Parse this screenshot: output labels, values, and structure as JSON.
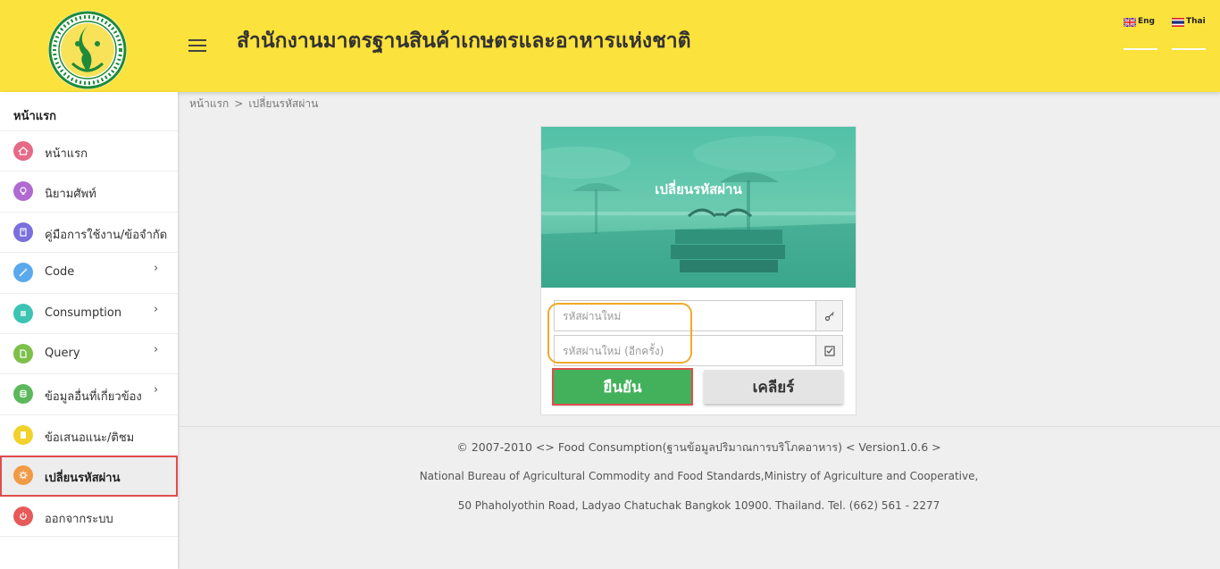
{
  "header": {
    "title": "สำนักงานมาตรฐานสินค้าเกษตรและอาหารแห่งชาติ",
    "lang_eng": "Eng",
    "lang_thai": "Thai"
  },
  "sidebar": {
    "heading": "หน้าแรก",
    "items": [
      {
        "label": "หน้าแรก",
        "icon": "home-icon",
        "color": "#e66a86",
        "has_submenu": false
      },
      {
        "label": "นิยามศัพท์",
        "icon": "bulb-icon",
        "color": "#b06ad2",
        "has_submenu": false
      },
      {
        "label": "คู่มือการใช้งาน/ข้อจำกัด",
        "icon": "book-icon",
        "color": "#7a6fdc",
        "has_submenu": false
      },
      {
        "label": "Code",
        "icon": "wand-icon",
        "color": "#5aa9ee",
        "has_submenu": true
      },
      {
        "label": "Consumption",
        "icon": "list-icon",
        "color": "#3cc3b3",
        "has_submenu": true
      },
      {
        "label": "Query",
        "icon": "document-icon",
        "color": "#7cc04a",
        "has_submenu": true
      },
      {
        "label": "ข้อมูลอื่นที่เกี่ยวข้อง",
        "icon": "database-icon",
        "color": "#5cb85c",
        "has_submenu": true
      },
      {
        "label": "ข้อเสนอแนะ/ติชม",
        "icon": "note-icon",
        "color": "#f2d22a",
        "has_submenu": false
      },
      {
        "label": "เปลี่ยนรหัสผ่าน",
        "icon": "gear-icon",
        "color": "#f29a46",
        "has_submenu": false,
        "active": true
      },
      {
        "label": "ออกจากระบบ",
        "icon": "power-icon",
        "color": "#e65a5a",
        "has_submenu": false
      }
    ],
    "chevron": "›"
  },
  "breadcrumb": {
    "home": "หน้าแรก",
    "separator": ">",
    "current": "เปลี่ยนรหัสผ่าน"
  },
  "form": {
    "title": "เปลี่ยนรหัสผ่าน",
    "new_password_placeholder": "รหัสผ่านใหม่",
    "new_password_value": "",
    "confirm_password_placeholder": "รหัสผ่านใหม่ (อีกครั้ง)",
    "confirm_password_value": "",
    "confirm_button": "ยืนยัน",
    "clear_button": "เคลียร์"
  },
  "footer": {
    "copyright": "© 2007-2010 <> Food Consumption(ฐานข้อมูลปริมาณการบริโภคอาหาร) < Version1.0.6 >",
    "org": "National Bureau of Agricultural Commodity and Food Standards,Ministry of Agriculture and Cooperative,",
    "address": "50 Phaholyothin Road, Ladyao Chatuchak Bangkok 10900. Thailand. Tel. (662) 561 - 2277"
  },
  "colors": {
    "header_bg": "#fce23c",
    "confirm_button": "#43b15c",
    "highlight_red": "#e04d4d",
    "highlight_orange": "#f0a92a"
  }
}
